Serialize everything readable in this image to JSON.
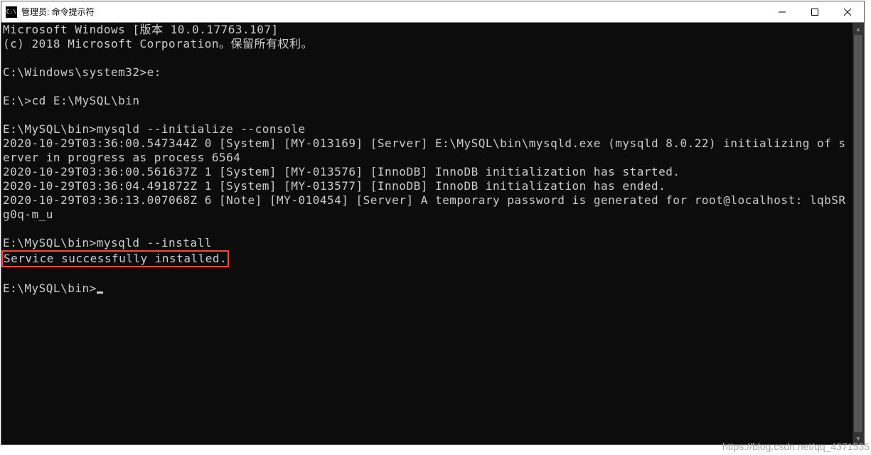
{
  "window": {
    "title": "管理员: 命令提示符",
    "icon_label": "cmd-icon"
  },
  "controls": {
    "minimize": "—",
    "maximize": "☐",
    "close": "✕"
  },
  "terminal": {
    "lines": [
      "Microsoft Windows [版本 10.0.17763.107]",
      "(c) 2018 Microsoft Corporation。保留所有权利。",
      "",
      "C:\\Windows\\system32>e:",
      "",
      "E:\\>cd E:\\MySQL\\bin",
      "",
      "E:\\MySQL\\bin>mysqld --initialize --console",
      "2020-10-29T03:36:00.547344Z 0 [System] [MY-013169] [Server] E:\\MySQL\\bin\\mysqld.exe (mysqld 8.0.22) initializing of server in progress as process 6564",
      "2020-10-29T03:36:00.561637Z 1 [System] [MY-013576] [InnoDB] InnoDB initialization has started.",
      "2020-10-29T03:36:04.491872Z 1 [System] [MY-013577] [InnoDB] InnoDB initialization has ended.",
      "2020-10-29T03:36:13.007068Z 6 [Note] [MY-010454] [Server] A temporary password is generated for root@localhost: lqbSRg0q-m_u",
      "",
      "E:\\MySQL\\bin>mysqld --install"
    ],
    "highlighted_line": "Service successfully installed.",
    "final_prompt": "E:\\MySQL\\bin>"
  },
  "watermark": "https://blog.csdn.net/qq_4371535"
}
